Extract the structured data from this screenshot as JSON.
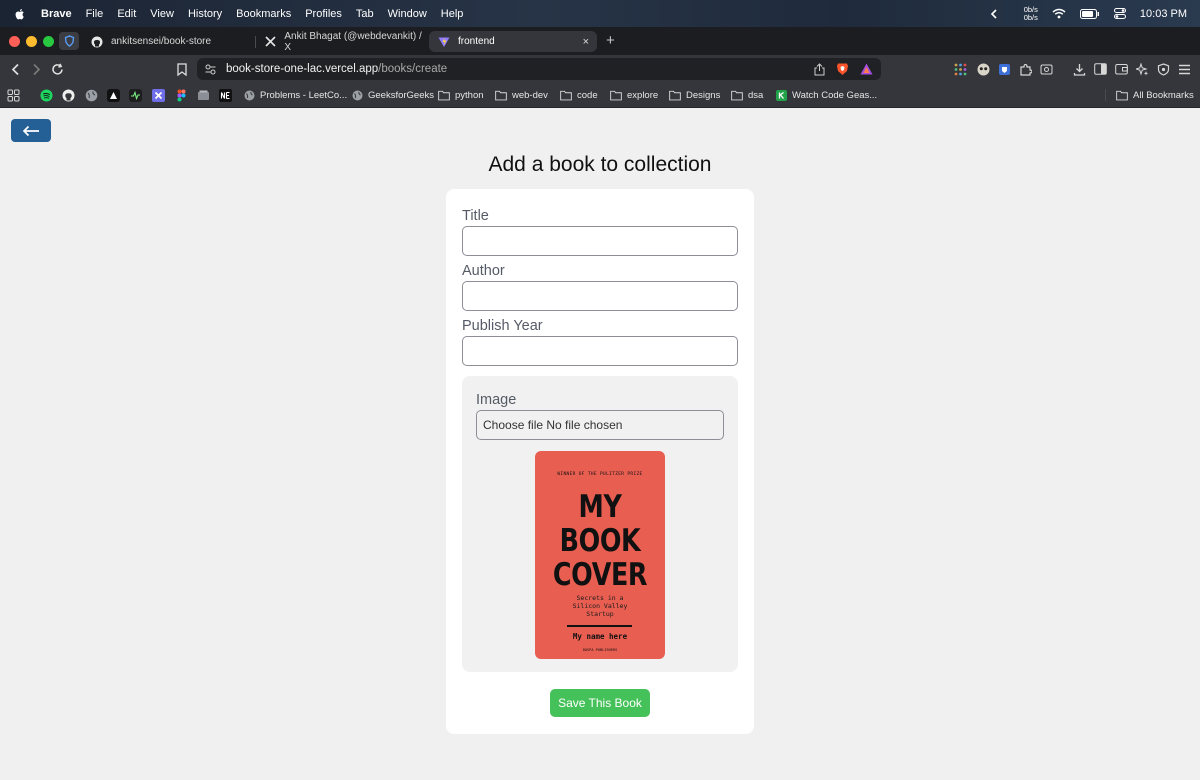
{
  "menubar": {
    "app_name": "Brave",
    "items": [
      "File",
      "Edit",
      "View",
      "History",
      "Bookmarks",
      "Profiles",
      "Tab",
      "Window",
      "Help"
    ],
    "net_up": "0b/s",
    "net_down": "0b/s",
    "time": "10:03 PM"
  },
  "tabs": [
    {
      "title": "ankitsensei/book-store",
      "icon": "github-icon"
    },
    {
      "title": "Ankit Bhagat (@webdevankit) / X",
      "icon": "x-icon"
    },
    {
      "title": "frontend",
      "icon": "vite-icon",
      "active": true,
      "close": "×"
    }
  ],
  "newtab_label": "+",
  "address": {
    "host": "book-store-one-lac.vercel.app",
    "path": "/books/create"
  },
  "bookmarks": [
    {
      "label": "Problems - LeetCo...",
      "icon": "globe-icon"
    },
    {
      "label": "GeeksforGeeks",
      "icon": "globe-icon"
    },
    {
      "label": "python",
      "icon": "folder-icon"
    },
    {
      "label": "web-dev",
      "icon": "folder-icon"
    },
    {
      "label": "code",
      "icon": "folder-icon"
    },
    {
      "label": "explore",
      "icon": "folder-icon"
    },
    {
      "label": "Designs",
      "icon": "folder-icon"
    },
    {
      "label": "dsa",
      "icon": "folder-icon"
    },
    {
      "label": "Watch Code Geas...",
      "icon": "k-icon"
    }
  ],
  "all_bookmarks": "All Bookmarks",
  "page": {
    "back_icon": "arrow-left-icon",
    "title": "Add a book to collection",
    "fields": {
      "title_label": "Title",
      "title_value": "",
      "author_label": "Author",
      "author_value": "",
      "year_label": "Publish Year",
      "year_value": ""
    },
    "image": {
      "label": "Image",
      "file_input_text": "Choose file No file chosen"
    },
    "cover": {
      "prize": "WINNER OF THE PULITZER PRIZE",
      "line1": "MY",
      "line2": "BOOK",
      "line3": "COVER",
      "subtitle_1": "Secrets in a",
      "subtitle_2": "Silicon Valley",
      "subtitle_3": "Startup",
      "author": "My name here",
      "publisher": "DOSPA PUBLISHERS"
    },
    "save_label": "Save This Book"
  },
  "colors": {
    "back_button": "#245f95",
    "save_button": "#45c15a",
    "cover": "#e85e51"
  }
}
